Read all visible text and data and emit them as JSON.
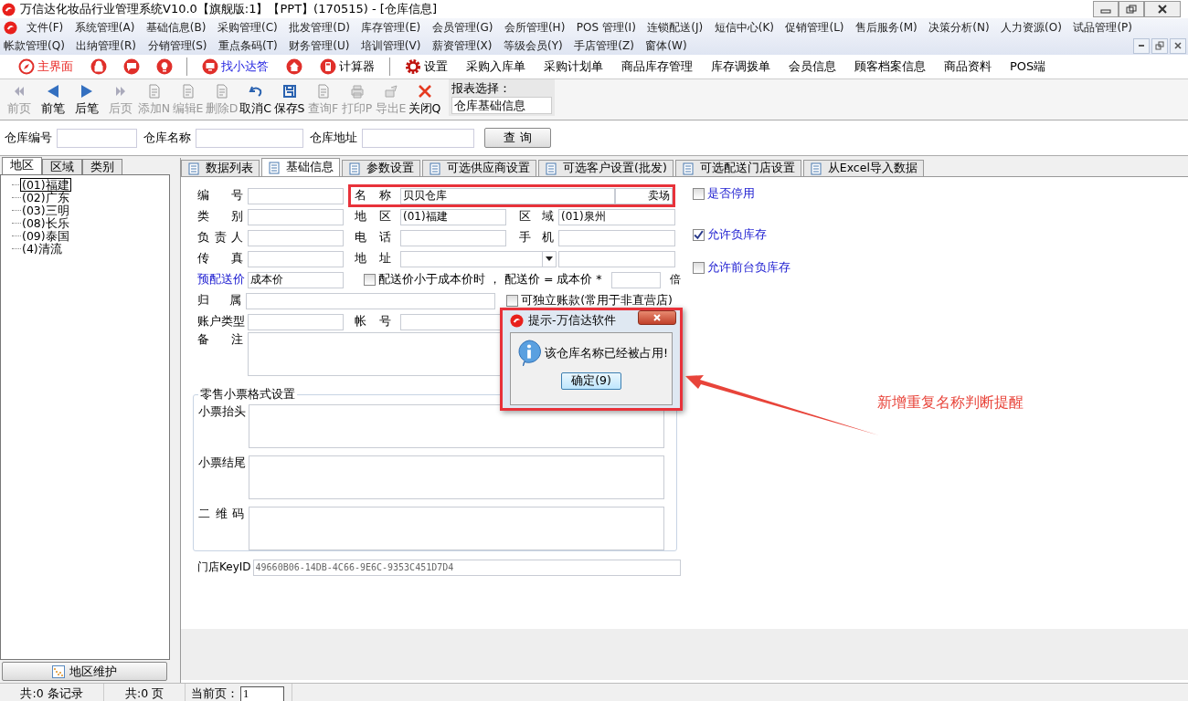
{
  "window": {
    "title": "万信达化妆品行业管理系统V10.0【旗舰版:1】【PPT】(170515) - [仓库信息]"
  },
  "menu_rows": [
    [
      "文件(F)",
      "系统管理(A)",
      "基础信息(B)",
      "采购管理(C)",
      "批发管理(D)",
      "库存管理(E)",
      "会员管理(G)",
      "会所管理(H)",
      "POS 管理(I)",
      "连锁配送(J)",
      "短信中心(K)",
      "促销管理(L)",
      "售后服务(M)",
      "决策分析(N)",
      "人力资源(O)",
      "试品管理(P)"
    ],
    [
      "帐款管理(Q)",
      "出纳管理(R)",
      "分销管理(S)",
      "重点条码(T)",
      "财务管理(U)",
      "培训管理(V)",
      "薪资管理(X)",
      "等级会员(Y)",
      "手店管理(Z)",
      "窗体(W)"
    ]
  ],
  "quick_bar": [
    {
      "kind": "primary",
      "label": "主界面"
    },
    {
      "kind": "icon-only"
    },
    {
      "kind": "icon-only"
    },
    {
      "kind": "icon-only"
    },
    {
      "kind": "separator"
    },
    {
      "kind": "link",
      "label": "找小达答"
    },
    {
      "kind": "icon-only"
    },
    {
      "kind": "plain",
      "label": "计算器"
    },
    {
      "kind": "separator"
    },
    {
      "kind": "plain",
      "label": "设置"
    },
    {
      "kind": "plain",
      "label": "采购入库单"
    },
    {
      "kind": "plain",
      "label": "采购计划单"
    },
    {
      "kind": "plain",
      "label": "商品库存管理"
    },
    {
      "kind": "plain",
      "label": "库存调拨单"
    },
    {
      "kind": "plain",
      "label": "会员信息"
    },
    {
      "kind": "plain",
      "label": "顾客档案信息"
    },
    {
      "kind": "plain",
      "label": "商品资料"
    },
    {
      "kind": "plain",
      "label": "POS端"
    }
  ],
  "toolbar": [
    {
      "label": "前页",
      "disabled": true
    },
    {
      "label": "前笔",
      "disabled": false
    },
    {
      "label": "后笔",
      "disabled": false
    },
    {
      "label": "后页",
      "disabled": true
    },
    {
      "label": "添加N",
      "disabled": true
    },
    {
      "label": "编辑E",
      "disabled": true
    },
    {
      "label": "删除D",
      "disabled": true
    },
    {
      "label": "取消C",
      "disabled": false
    },
    {
      "label": "保存S",
      "disabled": false
    },
    {
      "label": "查询F",
      "disabled": true
    },
    {
      "label": "打印P",
      "disabled": true
    },
    {
      "label": "导出E",
      "disabled": true
    },
    {
      "label": "关闭Q",
      "disabled": false
    }
  ],
  "report_select": {
    "label": "报表选择：",
    "value": "仓库基础信息"
  },
  "search": {
    "fields": [
      "仓库编号",
      "仓库名称",
      "仓库地址"
    ],
    "button": "查 询"
  },
  "left_tabs": [
    {
      "label": "地区",
      "selected": true
    },
    {
      "label": "区域",
      "selected": false
    },
    {
      "label": "类别",
      "selected": false
    }
  ],
  "tree": [
    {
      "label": "(01)福建",
      "selected": true
    },
    {
      "label": "(02)广东",
      "selected": false
    },
    {
      "label": "(03)三明",
      "selected": false
    },
    {
      "label": "(08)长乐",
      "selected": false
    },
    {
      "label": "(09)泰国",
      "selected": false
    },
    {
      "label": "(4)清流",
      "selected": false
    }
  ],
  "tree_button": "地区维护",
  "tabs": [
    {
      "label": "数据列表",
      "selected": false
    },
    {
      "label": "基础信息",
      "selected": true
    },
    {
      "label": "参数设置",
      "selected": false
    },
    {
      "label": "可选供应商设置",
      "selected": false
    },
    {
      "label": "可选客户设置(批发)",
      "selected": false
    },
    {
      "label": "可选配送门店设置",
      "selected": false
    },
    {
      "label": "从Excel导入数据",
      "selected": false
    }
  ],
  "form": {
    "code": {
      "label": "编号"
    },
    "name": {
      "label": "名称",
      "value": "贝贝仓库",
      "type": "卖场"
    },
    "category": {
      "label": "类别"
    },
    "region": {
      "label": "地区",
      "value": "(01)福建"
    },
    "area": {
      "label": "区域",
      "value": "(01)泉州"
    },
    "manager": {
      "label": "负责人"
    },
    "phone": {
      "label": "电话"
    },
    "mobile": {
      "label": "手机"
    },
    "fax": {
      "label": "传真"
    },
    "address": {
      "label": "地址"
    },
    "pre_price": {
      "label": "预配送价",
      "value": "成本价"
    },
    "price_rule": {
      "checked": false,
      "text": "配送价小于成本价时 ， 配送价 = 成本价 *",
      "suffix": "倍"
    },
    "belong": {
      "label": "归属"
    },
    "independent": {
      "label": "可独立账款(常用于非直营店)",
      "checked": false
    },
    "account_type": {
      "label": "账户类型"
    },
    "account_no": {
      "label": "帐号"
    },
    "remark": {
      "label": "备注"
    },
    "options": [
      {
        "label": "是否停用",
        "checked": false
      },
      {
        "label": "允许负库存",
        "checked": true
      },
      {
        "label": "允许前台负库存",
        "checked": false
      }
    ],
    "receipt": {
      "title": "零售小票格式设置",
      "fields": [
        "小票抬头",
        "小票结尾",
        "二维码"
      ]
    },
    "key_id": {
      "label": "门店KeyID",
      "value": "49660B06-14DB-4C66-9E6C-9353C451D7D4"
    }
  },
  "dialog": {
    "title": "提示-万信达软件",
    "message": "该仓库名称已经被占用!",
    "button": "确定(9)"
  },
  "annotation": {
    "text": "新增重复名称判断提醒"
  },
  "status_bar": {
    "records": "共:0 条记录",
    "pages": "共:0 页",
    "page_label": "当前页：",
    "page_value": "1"
  }
}
